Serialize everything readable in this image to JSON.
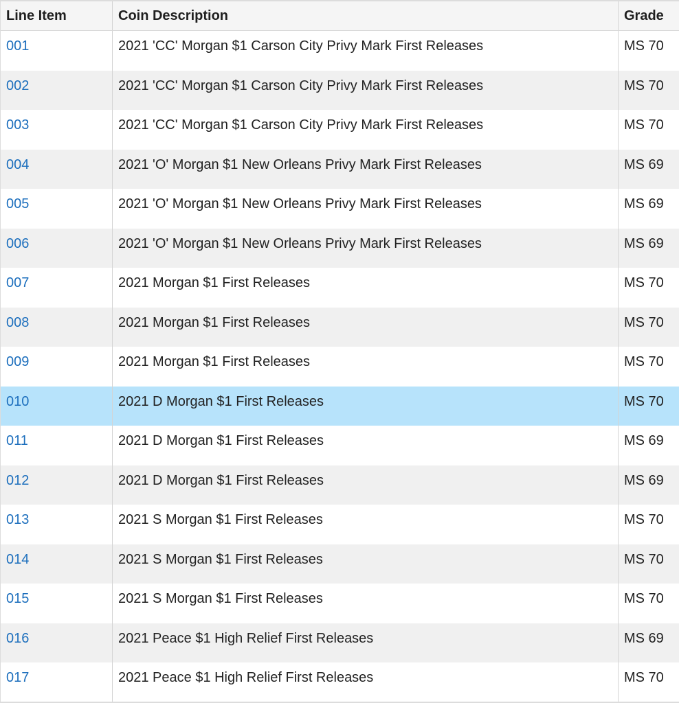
{
  "table": {
    "headers": {
      "line_item": "Line Item",
      "description": "Coin Description",
      "grade": "Grade"
    },
    "rows": [
      {
        "line_item": "001",
        "description": "2021 'CC' Morgan $1 Carson City Privy Mark First Releases",
        "grade": "MS 70"
      },
      {
        "line_item": "002",
        "description": "2021 'CC' Morgan $1 Carson City Privy Mark First Releases",
        "grade": "MS 70"
      },
      {
        "line_item": "003",
        "description": "2021 'CC' Morgan $1 Carson City Privy Mark First Releases",
        "grade": "MS 70"
      },
      {
        "line_item": "004",
        "description": "2021 'O' Morgan $1 New Orleans Privy Mark First Releases",
        "grade": "MS 69"
      },
      {
        "line_item": "005",
        "description": "2021 'O' Morgan $1 New Orleans Privy Mark First Releases",
        "grade": "MS 69"
      },
      {
        "line_item": "006",
        "description": "2021 'O' Morgan $1 New Orleans Privy Mark First Releases",
        "grade": "MS 69"
      },
      {
        "line_item": "007",
        "description": "2021 Morgan $1 First Releases",
        "grade": "MS 70"
      },
      {
        "line_item": "008",
        "description": "2021 Morgan $1 First Releases",
        "grade": "MS 70"
      },
      {
        "line_item": "009",
        "description": "2021 Morgan $1 First Releases",
        "grade": "MS 70"
      },
      {
        "line_item": "010",
        "description": "2021 D Morgan $1 First Releases",
        "grade": "MS 70"
      },
      {
        "line_item": "011",
        "description": "2021 D Morgan $1 First Releases",
        "grade": "MS 69"
      },
      {
        "line_item": "012",
        "description": "2021 D Morgan $1 First Releases",
        "grade": "MS 69"
      },
      {
        "line_item": "013",
        "description": "2021 S Morgan $1 First Releases",
        "grade": "MS 70"
      },
      {
        "line_item": "014",
        "description": "2021 S Morgan $1 First Releases",
        "grade": "MS 70"
      },
      {
        "line_item": "015",
        "description": "2021 S Morgan $1 First Releases",
        "grade": "MS 70"
      },
      {
        "line_item": "016",
        "description": "2021 Peace $1 High Relief First Releases",
        "grade": "MS 69"
      },
      {
        "line_item": "017",
        "description": "2021 Peace $1 High Relief First Releases",
        "grade": "MS 70"
      }
    ],
    "selected_line_item": "010",
    "colors": {
      "link": "#1d6fbd",
      "selected_row": "#b7e3fb",
      "alt_row": "#f0f0f0",
      "header_bg": "#f5f5f5"
    }
  }
}
